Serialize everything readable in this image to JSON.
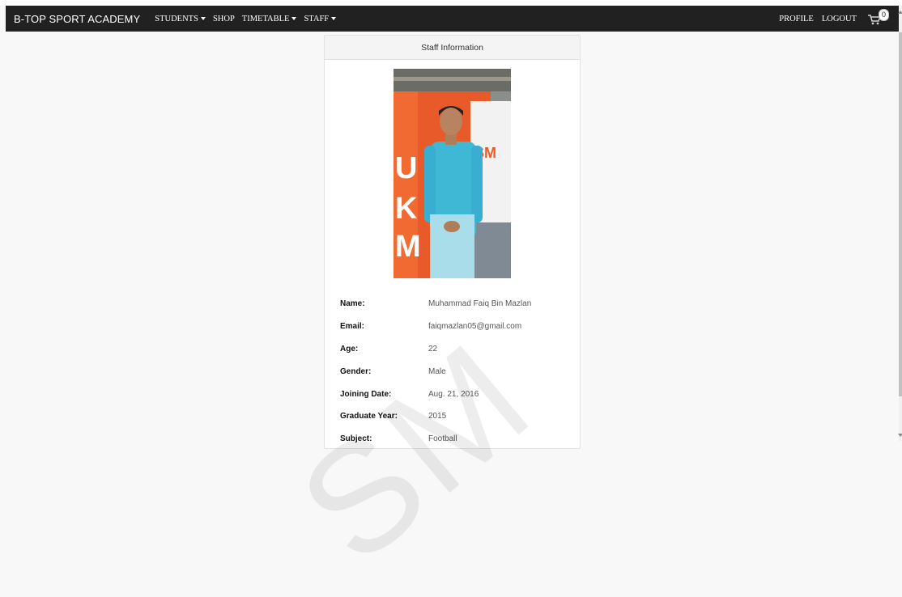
{
  "navbar": {
    "brand": "B-TOP SPORT ACADEMY",
    "items": [
      {
        "label": "STUDENTS",
        "dropdown": true
      },
      {
        "label": "SHOP",
        "dropdown": false
      },
      {
        "label": "TIMETABLE",
        "dropdown": true
      },
      {
        "label": "STAFF",
        "dropdown": true
      }
    ],
    "right_items": [
      {
        "label": "PROFILE"
      },
      {
        "label": "LOGOUT"
      }
    ],
    "cart": {
      "icon": "shopping-cart-icon",
      "count": "0"
    }
  },
  "card": {
    "header": "Staff Information",
    "photo": {
      "alt": "Staff photo"
    },
    "fields": [
      {
        "label": "Name:",
        "value": "Muhammad Faiq Bin Mazlan"
      },
      {
        "label": "Email:",
        "value": "faiqmazlan05@gmail.com"
      },
      {
        "label": "Age:",
        "value": "22"
      },
      {
        "label": "Gender:",
        "value": "Male"
      },
      {
        "label": "Joining Date:",
        "value": "Aug. 21, 2016"
      },
      {
        "label": "Graduate Year:",
        "value": "2015"
      },
      {
        "label": "Subject:",
        "value": "Football"
      }
    ]
  },
  "watermark": "SM",
  "colors": {
    "navbar_bg": "#212121",
    "page_bg": "#f8f8f8",
    "card_header_bg": "#f4f4f4"
  }
}
